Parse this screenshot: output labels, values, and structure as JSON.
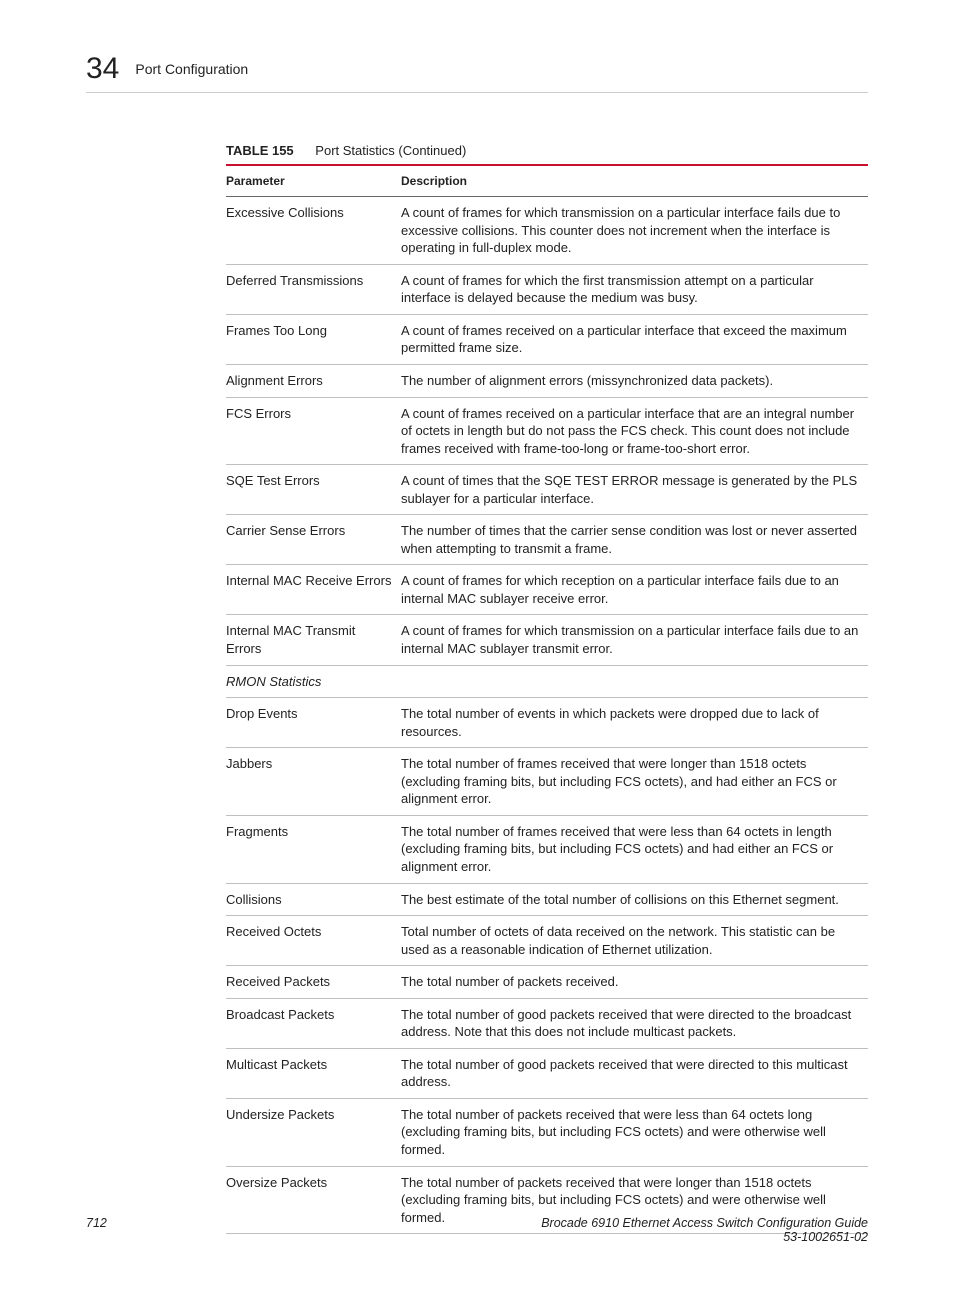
{
  "header": {
    "chapter_number": "34",
    "chapter_title": "Port Configuration"
  },
  "table": {
    "label": "TABLE 155",
    "title": "Port Statistics (Continued)",
    "head_param": "Parameter",
    "head_desc": "Description",
    "rows": [
      {
        "param": "Excessive Collisions",
        "desc": "A count of frames for which transmission on a particular interface fails due to excessive collisions. This counter does not increment when the interface is operating in full-duplex mode."
      },
      {
        "param": "Deferred Transmissions",
        "desc": "A count of frames for which the first transmission attempt on a particular interface is delayed because the medium was busy."
      },
      {
        "param": "Frames Too Long",
        "desc": "A count of frames received on a particular interface that exceed the maximum permitted frame size."
      },
      {
        "param": "Alignment Errors",
        "desc": "The number of alignment errors (missynchronized data packets)."
      },
      {
        "param": "FCS Errors",
        "desc": "A count of frames received on a particular interface that are an integral number of octets in length but do not pass the FCS check. This count does not include frames received with frame-too-long or frame-too-short error."
      },
      {
        "param": "SQE Test Errors",
        "desc": "A count of times that the SQE TEST ERROR message is generated by the PLS sublayer for a particular interface."
      },
      {
        "param": "Carrier Sense Errors",
        "desc": "The number of times that the carrier sense condition was lost or never asserted when attempting to transmit a frame."
      },
      {
        "param": "Internal MAC Receive Errors",
        "desc": "A count of frames for which reception on a particular interface fails due to an internal MAC sublayer receive error."
      },
      {
        "param": "Internal MAC Transmit Errors",
        "desc": "A count of frames for which transmission on a particular interface fails due to an internal MAC sublayer transmit error."
      },
      {
        "section": true,
        "param": "RMON Statistics",
        "desc": ""
      },
      {
        "param": "Drop Events",
        "desc": "The total number of events in which packets were dropped due to lack of resources."
      },
      {
        "param": "Jabbers",
        "desc": "The total number of frames received that were longer than 1518 octets (excluding framing bits, but including FCS octets), and had either an FCS or alignment error."
      },
      {
        "param": "Fragments",
        "desc": "The total number of frames received that were less than 64 octets in length (excluding framing bits, but including FCS octets) and had either an FCS or alignment error."
      },
      {
        "param": "Collisions",
        "desc": "The best estimate of the total number of collisions on this Ethernet segment."
      },
      {
        "param": "Received Octets",
        "desc": "Total number of octets of data received on the network. This statistic can be used as a reasonable indication of Ethernet utilization."
      },
      {
        "param": "Received Packets",
        "desc": "The total number of packets received."
      },
      {
        "param": "Broadcast Packets",
        "desc": "The total number of good packets received that were directed to the broadcast address. Note that this does not include multicast packets."
      },
      {
        "param": "Multicast Packets",
        "desc": "The total number of good packets received that were directed to this multicast address."
      },
      {
        "param": "Undersize Packets",
        "desc": "The total number of packets received that were less than 64 octets long (excluding framing bits, but including FCS octets) and were otherwise well formed."
      },
      {
        "param": "Oversize Packets",
        "desc": "The total number of packets received that were longer than 1518 octets (excluding framing bits, but including FCS octets) and were otherwise well formed."
      }
    ]
  },
  "footer": {
    "page_number": "712",
    "doc_title": "Brocade 6910 Ethernet Access Switch Configuration Guide",
    "doc_number": "53-1002651-02"
  }
}
